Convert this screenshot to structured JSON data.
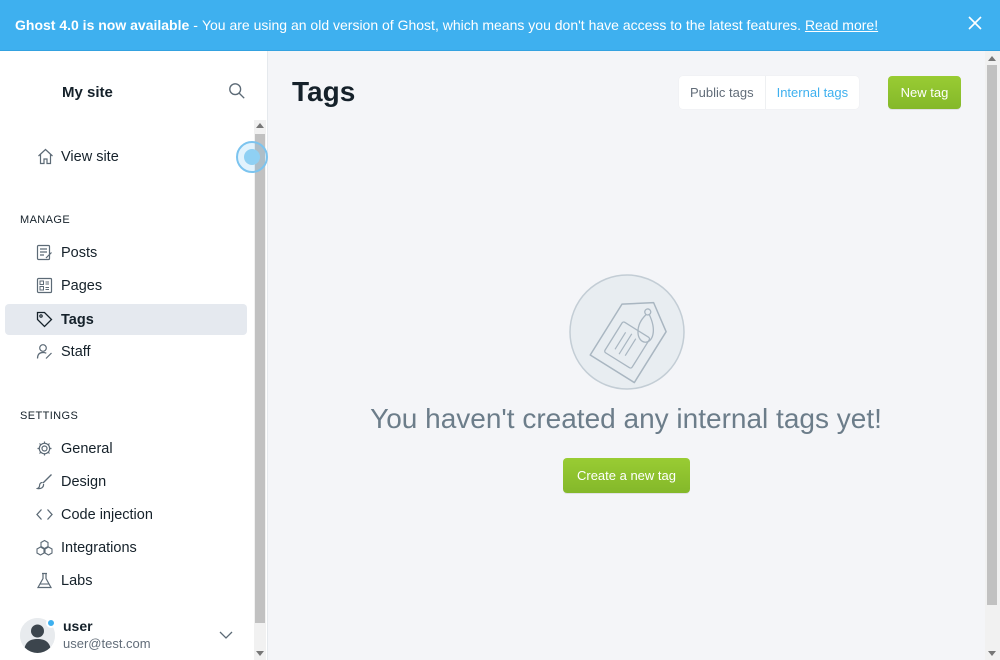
{
  "banner": {
    "title": "Ghost 4.0 is now available",
    "separator": "-",
    "message": "You are using an old version of Ghost, which means you don't have access to the latest features.",
    "link": "Read more!",
    "close_icon": "close-icon",
    "color": "#3eb0ef"
  },
  "sidebar": {
    "site_title": "My site",
    "search_icon": "search-icon",
    "view_site": {
      "label": "View site",
      "icon": "home-icon"
    },
    "manage_label": "MANAGE",
    "manage_items": [
      {
        "label": "Posts",
        "icon": "posts-icon"
      },
      {
        "label": "Pages",
        "icon": "pages-icon"
      },
      {
        "label": "Tags",
        "icon": "tag-icon",
        "active": true
      },
      {
        "label": "Staff",
        "icon": "staff-icon"
      }
    ],
    "settings_label": "SETTINGS",
    "settings_items": [
      {
        "label": "General",
        "icon": "gear-icon"
      },
      {
        "label": "Design",
        "icon": "brush-icon"
      },
      {
        "label": "Code injection",
        "icon": "code-icon"
      },
      {
        "label": "Integrations",
        "icon": "integrations-icon"
      },
      {
        "label": "Labs",
        "icon": "flask-icon"
      }
    ],
    "user": {
      "name": "user",
      "email": "user@test.com"
    }
  },
  "main": {
    "title": "Tags",
    "tabs": [
      {
        "label": "Public tags",
        "active": false
      },
      {
        "label": "Internal tags",
        "active": true
      }
    ],
    "new_tag_button": "New tag",
    "empty_message": "You haven't created any internal tags yet!",
    "create_button": "Create a new tag",
    "accent_color": "#8ec42b"
  }
}
